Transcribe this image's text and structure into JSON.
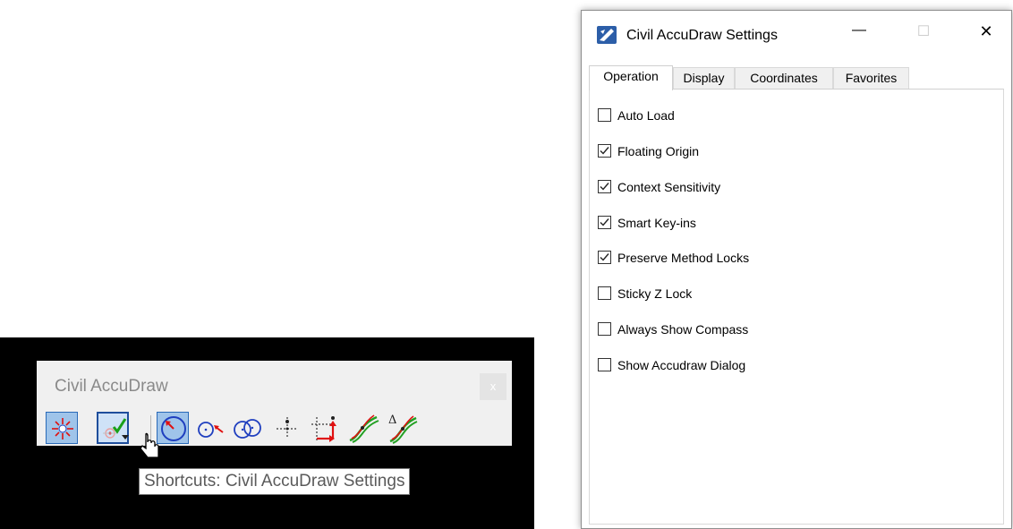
{
  "toolbar": {
    "title": "Civil AccuDraw",
    "close_label": "x",
    "tooltip": "Shortcuts: Civil AccuDraw Settings",
    "tools": [
      {
        "icon": "accudraw-compass-icon",
        "state": "active"
      },
      {
        "icon": "settings-check-icon",
        "state": "pressed"
      },
      {
        "icon": "circle-center-icon",
        "state": "active"
      },
      {
        "icon": "circle-point-icon",
        "state": "normal"
      },
      {
        "icon": "two-circles-icon",
        "state": "normal"
      },
      {
        "icon": "crosshair-origin-icon",
        "state": "normal"
      },
      {
        "icon": "offset-arrow-icon",
        "state": "normal"
      },
      {
        "icon": "alignment-curve-icon",
        "state": "normal"
      },
      {
        "icon": "delta-curve-icon",
        "state": "normal"
      }
    ]
  },
  "dialog": {
    "title": "Civil AccuDraw Settings",
    "controls": {
      "minimize": "—",
      "maximize": "☐",
      "close": "✕"
    },
    "tabs": [
      "Operation",
      "Display",
      "Coordinates",
      "Favorites"
    ],
    "selected_tab": "Operation",
    "options": [
      {
        "label": "Auto Load",
        "checked": false
      },
      {
        "label": "Floating Origin",
        "checked": true
      },
      {
        "label": "Context Sensitivity",
        "checked": true
      },
      {
        "label": "Smart Key-ins",
        "checked": true
      },
      {
        "label": "Preserve Method Locks",
        "checked": true
      },
      {
        "label": "Sticky Z Lock",
        "checked": false
      },
      {
        "label": "Always Show Compass",
        "checked": false
      },
      {
        "label": "Show Accudraw Dialog",
        "checked": false
      }
    ]
  },
  "colors": {
    "active_tool": "#9fc4ea",
    "tool_border": "#2a6ab8",
    "icon_blue": "#1f3fbf",
    "icon_red": "#e01010",
    "icon_green": "#22a022"
  }
}
